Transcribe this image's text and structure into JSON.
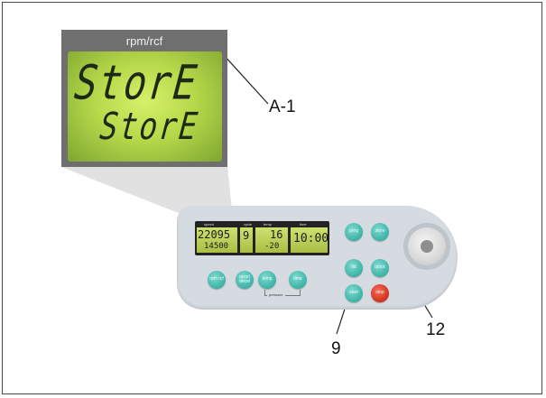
{
  "zoom_display": {
    "title": "rpm/rcf",
    "line1": "StorE",
    "line2": "StorE"
  },
  "callouts": {
    "a1": "A-1",
    "c9": "9",
    "c12": "12"
  },
  "device": {
    "lcd": {
      "speed_head": "speed",
      "cycle_head": "cycle",
      "temp_head": "temp",
      "time_head": "time",
      "speed_top": "22095",
      "speed_bottom": "14500",
      "cycle": "9",
      "temp_top": "16",
      "temp_bottom": "-20",
      "time": "10:00"
    },
    "buttons": {
      "rpm_rcf": "rpm rcf",
      "accel_decel": "accel decel",
      "temp": "temp",
      "time": "time",
      "prog": "prog",
      "store": "store",
      "lid": "lid",
      "quick": "quick",
      "start": "start",
      "stop": "stop"
    },
    "pressure_label": "pressure"
  },
  "colors": {
    "lcd_green": "#b6d94a",
    "button_teal": "#3bb3a6",
    "button_stop": "#d3311b",
    "panel": "#d6dbe2"
  }
}
